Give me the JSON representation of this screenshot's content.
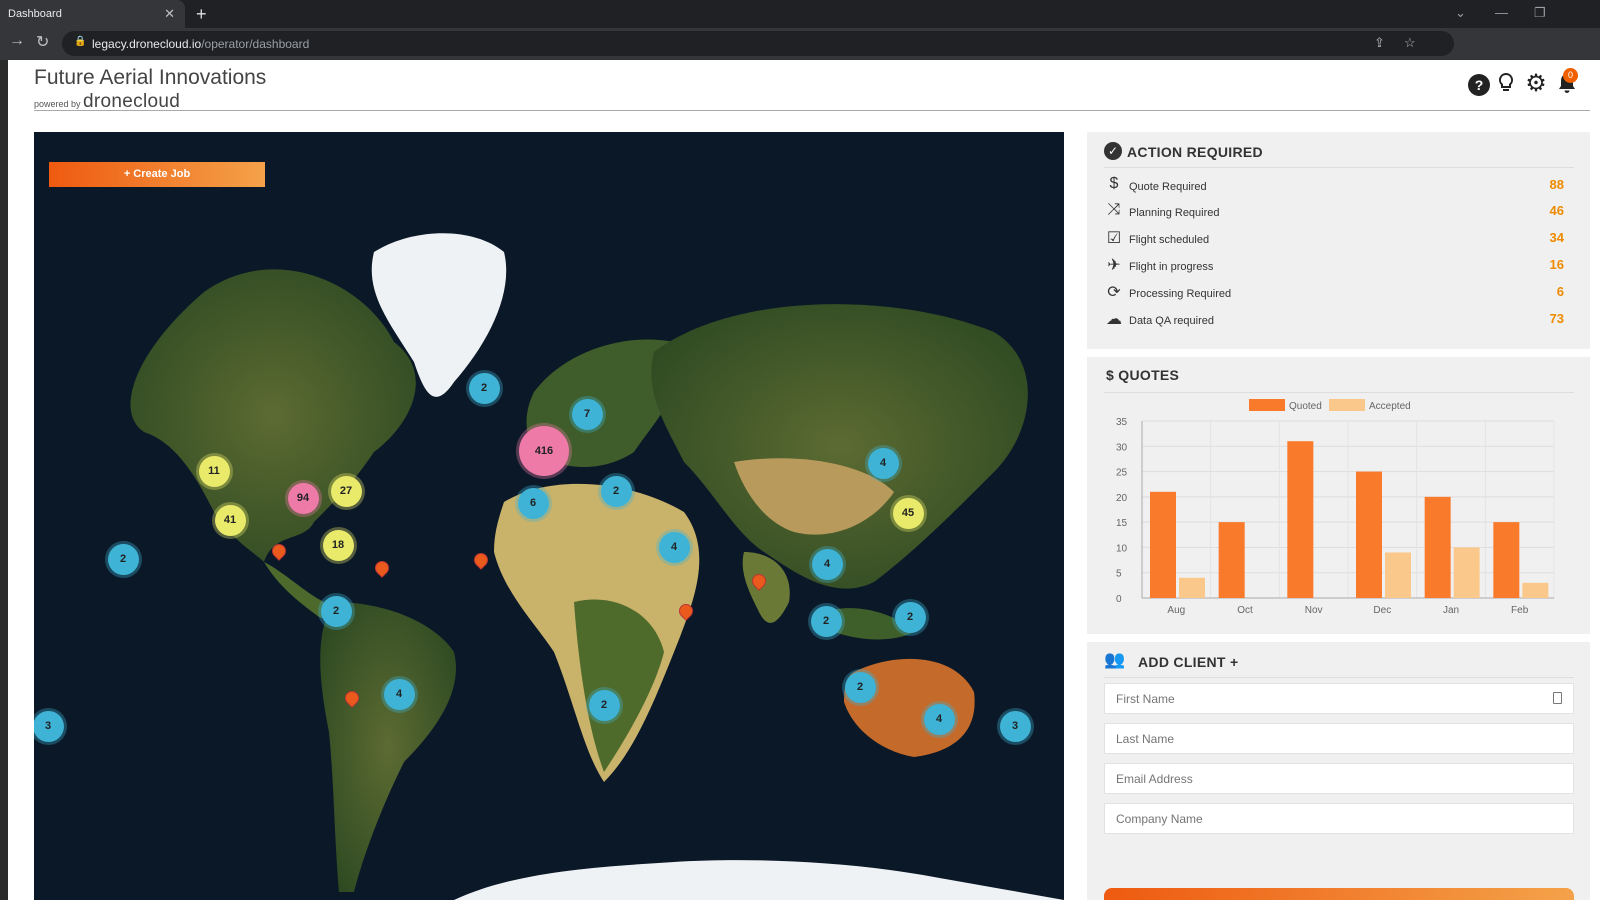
{
  "browser": {
    "tab_title": "Dashboard",
    "tab_close": "✕",
    "new_tab": "+",
    "url_host": "legacy.dronecloud.io",
    "url_path": "/operator/dashboard"
  },
  "header": {
    "title": "Future Aerial Innovations",
    "powered_by": "powered by",
    "logo_text": "dronecloud",
    "notification_count": "0"
  },
  "map": {
    "create_job_label": "+ Create Job",
    "clusters": [
      {
        "label": "2",
        "color": "#3eb3d6"
      },
      {
        "label": "7",
        "color": "#3eb3d6"
      },
      {
        "label": "416",
        "color": "#ee7aa8"
      },
      {
        "label": "11",
        "color": "#eaea6a"
      },
      {
        "label": "94",
        "color": "#ee7aa8"
      },
      {
        "label": "27",
        "color": "#eaea6a"
      },
      {
        "label": "41",
        "color": "#eaea6a"
      },
      {
        "label": "18",
        "color": "#eaea6a"
      },
      {
        "label": "2",
        "color": "#3eb3d6"
      },
      {
        "label": "2",
        "color": "#3eb3d6"
      },
      {
        "label": "6",
        "color": "#3eb3d6"
      },
      {
        "label": "2",
        "color": "#3eb3d6"
      },
      {
        "label": "4",
        "color": "#3eb3d6"
      },
      {
        "label": "4",
        "color": "#3eb3d6"
      },
      {
        "label": "45",
        "color": "#eaea6a"
      },
      {
        "label": "4",
        "color": "#3eb3d6"
      },
      {
        "label": "2",
        "color": "#3eb3d6"
      },
      {
        "label": "2",
        "color": "#3eb3d6"
      },
      {
        "label": "4",
        "color": "#3eb3d6"
      },
      {
        "label": "2",
        "color": "#3eb3d6"
      },
      {
        "label": "2",
        "color": "#3eb3d6"
      },
      {
        "label": "4",
        "color": "#3eb3d6"
      },
      {
        "label": "3",
        "color": "#3eb3d6"
      },
      {
        "label": "3",
        "color": "#3eb3d6"
      }
    ]
  },
  "action_required": {
    "title": "ACTION REQUIRED",
    "items": [
      {
        "icon": "dollar-icon",
        "label": "Quote Required",
        "count": "88"
      },
      {
        "icon": "route-icon",
        "label": "Planning Required",
        "count": "46"
      },
      {
        "icon": "checkbox-icon",
        "label": "Flight scheduled",
        "count": "34"
      },
      {
        "icon": "plane-icon",
        "label": "Flight in progress",
        "count": "16"
      },
      {
        "icon": "refresh-icon",
        "label": "Processing Required",
        "count": "6"
      },
      {
        "icon": "cloud-upload-icon",
        "label": "Data QA required",
        "count": "73"
      }
    ]
  },
  "quotes": {
    "title": "$ QUOTES"
  },
  "chart_data": {
    "type": "bar",
    "categories": [
      "Aug",
      "Oct",
      "Nov",
      "Dec",
      "Jan",
      "Feb"
    ],
    "series": [
      {
        "name": "Quoted",
        "values": [
          21,
          15,
          31,
          25,
          20,
          15
        ],
        "color": "#f97a2a"
      },
      {
        "name": "Accepted",
        "values": [
          4,
          0,
          0,
          9,
          10,
          3
        ],
        "color": "#fbc88c"
      }
    ],
    "yticks": [
      "0",
      "5",
      "10",
      "15",
      "20",
      "25",
      "30",
      "35"
    ],
    "ylim": [
      0,
      35
    ],
    "grid": true,
    "legend": "top"
  },
  "add_client": {
    "title": "ADD CLIENT +",
    "first_name_placeholder": "First Name",
    "last_name_placeholder": "Last Name",
    "email_placeholder": "Email Address",
    "company_placeholder": "Company Name"
  }
}
